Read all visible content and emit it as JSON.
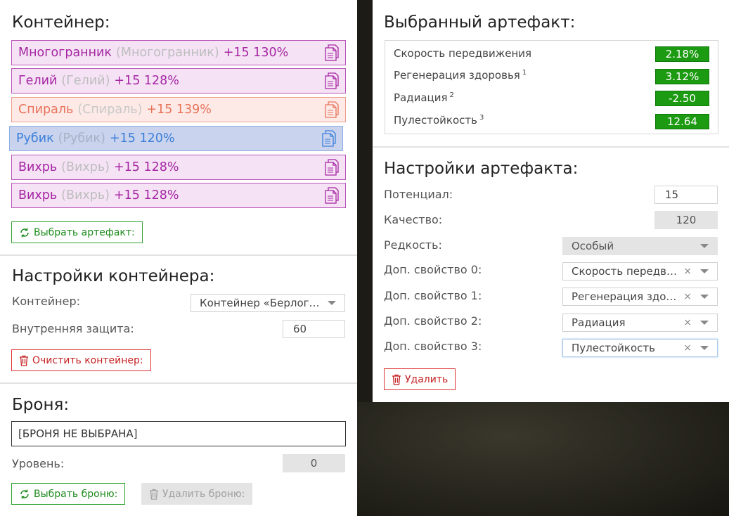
{
  "container": {
    "title": "Контейнер:",
    "artifacts": [
      {
        "name": "Многогранник",
        "alt": "(Многогранник)",
        "bonus": "+15 130%",
        "color": "#a626a4",
        "bg": "#f5e3f5",
        "border": "#b954b7",
        "alt_color": "#bdbdbd"
      },
      {
        "name": "Гелий",
        "alt": "(Гелий)",
        "bonus": "+15 128%",
        "color": "#a626a4",
        "bg": "#f5e3f5",
        "border": "#b954b7",
        "alt_color": "#bdbdbd"
      },
      {
        "name": "Спираль",
        "alt": "(Спираль)",
        "bonus": "+15 139%",
        "color": "#e8735b",
        "bg": "#fdeae6",
        "border": "#ef9d8d",
        "alt_color": "#c8c8c8"
      },
      {
        "name": "Рубик",
        "alt": "(Рубик)",
        "bonus": "+15 120%",
        "color": "#3b7fd9",
        "bg": "#c9d3ee",
        "border": "#8eaee4",
        "alt_color": "#a8b0c4"
      },
      {
        "name": "Вихрь",
        "alt": "(Вихрь)",
        "bonus": "+15 128%",
        "color": "#a626a4",
        "bg": "#f5e3f5",
        "border": "#b954b7",
        "alt_color": "#bdbdbd"
      },
      {
        "name": "Вихрь",
        "alt": "(Вихрь)",
        "bonus": "+15 128%",
        "color": "#a626a4",
        "bg": "#f5e3f5",
        "border": "#b954b7",
        "alt_color": "#bdbdbd"
      }
    ],
    "select_button": "Выбрать артефакт:"
  },
  "container_settings": {
    "title": "Настройки контейнера:",
    "container_label": "Контейнер:",
    "container_value": "Контейнер «Берлога...",
    "protection_label": "Внутренняя защита:",
    "protection_value": "60",
    "clear_button": "Очистить контейнер:"
  },
  "armor": {
    "title": "Броня:",
    "value": "[БРОНЯ НЕ ВЫБРАНА]",
    "level_label": "Уровень:",
    "level_value": "0",
    "select_button": "Выбрать броню:",
    "delete_button": "Удалить броню:"
  },
  "selected_artifact": {
    "title": "Выбранный артефакт:",
    "stats": [
      {
        "label": "Скорость передвижения",
        "sup": "",
        "value": "2.18%"
      },
      {
        "label": "Регенерация здоровья",
        "sup": "1",
        "value": "3.12%"
      },
      {
        "label": "Радиация",
        "sup": "2",
        "value": "-2.50"
      },
      {
        "label": "Пулестойкость",
        "sup": "3",
        "value": "12.64"
      }
    ]
  },
  "artifact_settings": {
    "title": "Настройки артефакта:",
    "potential_label": "Потенциал:",
    "potential_value": "15",
    "quality_label": "Качество:",
    "quality_value": "120",
    "rarity_label": "Редкость:",
    "rarity_value": "Особый",
    "props": [
      {
        "label": "Доп. свойство 0:",
        "value": "Скорость передвижения"
      },
      {
        "label": "Доп. свойство 1:",
        "value": "Регенерация здоровья"
      },
      {
        "label": "Доп. свойство 2:",
        "value": "Радиация"
      },
      {
        "label": "Доп. свойство 3:",
        "value": "Пулестойкость"
      }
    ],
    "clear_symbol": "×",
    "delete_button": "Удалить"
  }
}
